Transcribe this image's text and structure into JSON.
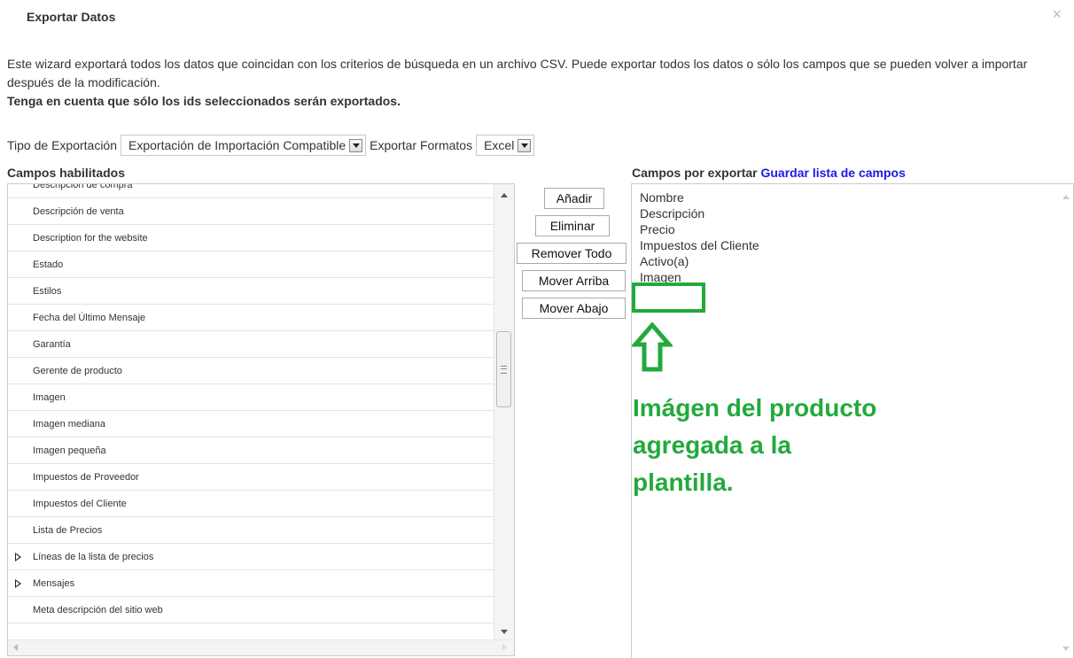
{
  "dialog": {
    "title": "Exportar Datos",
    "close_symbol": "×",
    "intro_text": "Este wizard exportará todos los datos que coincidan con los criterios de búsqueda en un archivo CSV. Puede exportar todos los datos o sólo los campos que se pueden volver a importar después de la modificación.",
    "note_text": "Tenga en cuenta que sólo los ids seleccionados serán exportados."
  },
  "options": {
    "export_type_label": "Tipo de Exportación",
    "export_type_value": "Exportación de Importación Compatible",
    "export_format_label": "Exportar Formatos",
    "export_format_value": "Excel"
  },
  "enabled_fields": {
    "label": "Campos habilitados",
    "items": [
      {
        "label": "Descripción de compra",
        "expandable": false
      },
      {
        "label": "Descripción de venta",
        "expandable": false
      },
      {
        "label": "Description for the website",
        "expandable": false
      },
      {
        "label": "Estado",
        "expandable": false
      },
      {
        "label": "Estilos",
        "expandable": false
      },
      {
        "label": "Fecha del Último Mensaje",
        "expandable": false
      },
      {
        "label": "Garantía",
        "expandable": false
      },
      {
        "label": "Gerente de producto",
        "expandable": false
      },
      {
        "label": "Imagen",
        "expandable": false
      },
      {
        "label": "Imagen mediana",
        "expandable": false
      },
      {
        "label": "Imagen pequeña",
        "expandable": false
      },
      {
        "label": "Impuestos de Proveedor",
        "expandable": false
      },
      {
        "label": "Impuestos del Cliente",
        "expandable": false
      },
      {
        "label": "Lista de Precios",
        "expandable": false
      },
      {
        "label": "Líneas de la lista de precios",
        "expandable": true
      },
      {
        "label": "Mensajes",
        "expandable": true
      },
      {
        "label": "Meta descripción del sitio web",
        "expandable": false
      }
    ]
  },
  "actions": {
    "add": "Añadir",
    "remove": "Eliminar",
    "remove_all": "Remover Todo",
    "move_up": "Mover Arriba",
    "move_down": "Mover Abajo"
  },
  "export_fields": {
    "label": "Campos por exportar",
    "save_link": "Guardar lista de campos",
    "items": [
      "Nombre",
      "Descripción",
      "Precio",
      "Impuestos del Cliente",
      "Activo(a)",
      "Imagen"
    ]
  },
  "annotation": {
    "lines": [
      "Imágen del producto",
      "agregada a la",
      "plantilla."
    ],
    "color": "#22aa3c"
  }
}
